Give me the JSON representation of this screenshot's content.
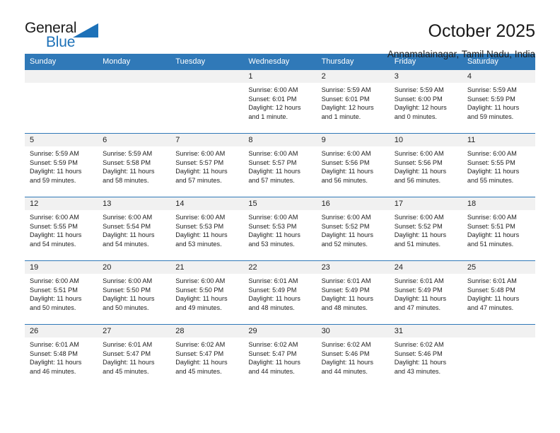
{
  "logo": {
    "text_top": "General",
    "text_bottom": "Blue",
    "icon": "triangle-icon",
    "brand_color": "#1d71b8"
  },
  "header": {
    "title": "October 2025",
    "subtitle": "Annamalainagar, Tamil Nadu, India"
  },
  "theme": {
    "header_blue": "#3079b8",
    "daynum_gray": "#f1f1f1",
    "text": "#222222"
  },
  "weekday_headers": [
    "Sunday",
    "Monday",
    "Tuesday",
    "Wednesday",
    "Thursday",
    "Friday",
    "Saturday"
  ],
  "weeks": [
    [
      {
        "day": "",
        "lines": []
      },
      {
        "day": "",
        "lines": []
      },
      {
        "day": "",
        "lines": []
      },
      {
        "day": "1",
        "lines": [
          "Sunrise: 6:00 AM",
          "Sunset: 6:01 PM",
          "Daylight: 12 hours",
          "and 1 minute."
        ]
      },
      {
        "day": "2",
        "lines": [
          "Sunrise: 5:59 AM",
          "Sunset: 6:01 PM",
          "Daylight: 12 hours",
          "and 1 minute."
        ]
      },
      {
        "day": "3",
        "lines": [
          "Sunrise: 5:59 AM",
          "Sunset: 6:00 PM",
          "Daylight: 12 hours",
          "and 0 minutes."
        ]
      },
      {
        "day": "4",
        "lines": [
          "Sunrise: 5:59 AM",
          "Sunset: 5:59 PM",
          "Daylight: 11 hours",
          "and 59 minutes."
        ]
      }
    ],
    [
      {
        "day": "5",
        "lines": [
          "Sunrise: 5:59 AM",
          "Sunset: 5:59 PM",
          "Daylight: 11 hours",
          "and 59 minutes."
        ]
      },
      {
        "day": "6",
        "lines": [
          "Sunrise: 5:59 AM",
          "Sunset: 5:58 PM",
          "Daylight: 11 hours",
          "and 58 minutes."
        ]
      },
      {
        "day": "7",
        "lines": [
          "Sunrise: 6:00 AM",
          "Sunset: 5:57 PM",
          "Daylight: 11 hours",
          "and 57 minutes."
        ]
      },
      {
        "day": "8",
        "lines": [
          "Sunrise: 6:00 AM",
          "Sunset: 5:57 PM",
          "Daylight: 11 hours",
          "and 57 minutes."
        ]
      },
      {
        "day": "9",
        "lines": [
          "Sunrise: 6:00 AM",
          "Sunset: 5:56 PM",
          "Daylight: 11 hours",
          "and 56 minutes."
        ]
      },
      {
        "day": "10",
        "lines": [
          "Sunrise: 6:00 AM",
          "Sunset: 5:56 PM",
          "Daylight: 11 hours",
          "and 56 minutes."
        ]
      },
      {
        "day": "11",
        "lines": [
          "Sunrise: 6:00 AM",
          "Sunset: 5:55 PM",
          "Daylight: 11 hours",
          "and 55 minutes."
        ]
      }
    ],
    [
      {
        "day": "12",
        "lines": [
          "Sunrise: 6:00 AM",
          "Sunset: 5:55 PM",
          "Daylight: 11 hours",
          "and 54 minutes."
        ]
      },
      {
        "day": "13",
        "lines": [
          "Sunrise: 6:00 AM",
          "Sunset: 5:54 PM",
          "Daylight: 11 hours",
          "and 54 minutes."
        ]
      },
      {
        "day": "14",
        "lines": [
          "Sunrise: 6:00 AM",
          "Sunset: 5:53 PM",
          "Daylight: 11 hours",
          "and 53 minutes."
        ]
      },
      {
        "day": "15",
        "lines": [
          "Sunrise: 6:00 AM",
          "Sunset: 5:53 PM",
          "Daylight: 11 hours",
          "and 53 minutes."
        ]
      },
      {
        "day": "16",
        "lines": [
          "Sunrise: 6:00 AM",
          "Sunset: 5:52 PM",
          "Daylight: 11 hours",
          "and 52 minutes."
        ]
      },
      {
        "day": "17",
        "lines": [
          "Sunrise: 6:00 AM",
          "Sunset: 5:52 PM",
          "Daylight: 11 hours",
          "and 51 minutes."
        ]
      },
      {
        "day": "18",
        "lines": [
          "Sunrise: 6:00 AM",
          "Sunset: 5:51 PM",
          "Daylight: 11 hours",
          "and 51 minutes."
        ]
      }
    ],
    [
      {
        "day": "19",
        "lines": [
          "Sunrise: 6:00 AM",
          "Sunset: 5:51 PM",
          "Daylight: 11 hours",
          "and 50 minutes."
        ]
      },
      {
        "day": "20",
        "lines": [
          "Sunrise: 6:00 AM",
          "Sunset: 5:50 PM",
          "Daylight: 11 hours",
          "and 50 minutes."
        ]
      },
      {
        "day": "21",
        "lines": [
          "Sunrise: 6:00 AM",
          "Sunset: 5:50 PM",
          "Daylight: 11 hours",
          "and 49 minutes."
        ]
      },
      {
        "day": "22",
        "lines": [
          "Sunrise: 6:01 AM",
          "Sunset: 5:49 PM",
          "Daylight: 11 hours",
          "and 48 minutes."
        ]
      },
      {
        "day": "23",
        "lines": [
          "Sunrise: 6:01 AM",
          "Sunset: 5:49 PM",
          "Daylight: 11 hours",
          "and 48 minutes."
        ]
      },
      {
        "day": "24",
        "lines": [
          "Sunrise: 6:01 AM",
          "Sunset: 5:49 PM",
          "Daylight: 11 hours",
          "and 47 minutes."
        ]
      },
      {
        "day": "25",
        "lines": [
          "Sunrise: 6:01 AM",
          "Sunset: 5:48 PM",
          "Daylight: 11 hours",
          "and 47 minutes."
        ]
      }
    ],
    [
      {
        "day": "26",
        "lines": [
          "Sunrise: 6:01 AM",
          "Sunset: 5:48 PM",
          "Daylight: 11 hours",
          "and 46 minutes."
        ]
      },
      {
        "day": "27",
        "lines": [
          "Sunrise: 6:01 AM",
          "Sunset: 5:47 PM",
          "Daylight: 11 hours",
          "and 45 minutes."
        ]
      },
      {
        "day": "28",
        "lines": [
          "Sunrise: 6:02 AM",
          "Sunset: 5:47 PM",
          "Daylight: 11 hours",
          "and 45 minutes."
        ]
      },
      {
        "day": "29",
        "lines": [
          "Sunrise: 6:02 AM",
          "Sunset: 5:47 PM",
          "Daylight: 11 hours",
          "and 44 minutes."
        ]
      },
      {
        "day": "30",
        "lines": [
          "Sunrise: 6:02 AM",
          "Sunset: 5:46 PM",
          "Daylight: 11 hours",
          "and 44 minutes."
        ]
      },
      {
        "day": "31",
        "lines": [
          "Sunrise: 6:02 AM",
          "Sunset: 5:46 PM",
          "Daylight: 11 hours",
          "and 43 minutes."
        ]
      },
      {
        "day": "",
        "lines": []
      }
    ]
  ]
}
